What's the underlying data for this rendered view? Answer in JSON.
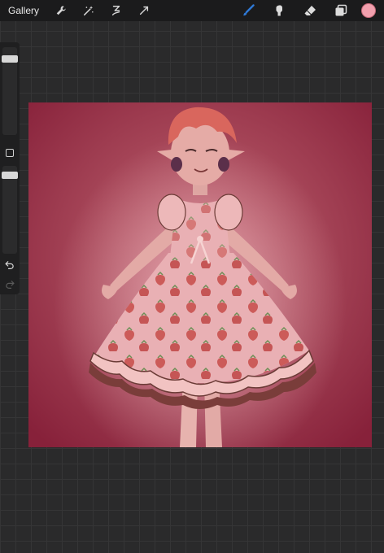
{
  "toolbar": {
    "gallery_label": "Gallery",
    "left_tools": [
      "wrench-icon",
      "magic-wand-icon",
      "selection-icon",
      "transform-icon"
    ],
    "right_tools": [
      "brush-icon",
      "smudge-icon",
      "eraser-icon",
      "layers-icon"
    ],
    "active_tool": "brush-icon",
    "brush_color": "#2f79d6",
    "current_color": "#f2a0ae"
  },
  "sidebar": {
    "controls": [
      "brush-size-slider",
      "modify-button",
      "opacity-slider",
      "undo-button",
      "redo-button"
    ]
  },
  "canvas": {
    "background_color": "#8e2a3c",
    "artwork": "strawberry-dress-character"
  }
}
